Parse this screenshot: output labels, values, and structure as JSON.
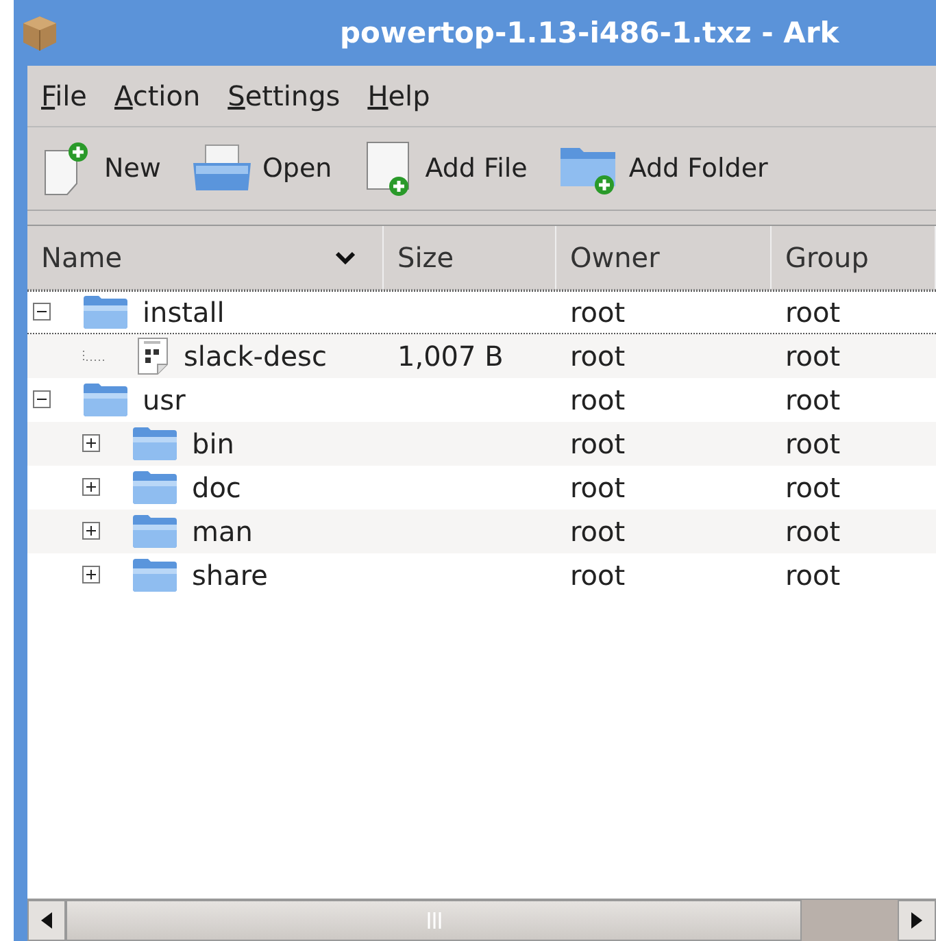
{
  "window": {
    "title": "powertop-1.13-i486-1.txz - Ark"
  },
  "menu": [
    "File",
    "Action",
    "Settings",
    "Help"
  ],
  "toolbar": [
    {
      "kind": "new",
      "label": "New"
    },
    {
      "kind": "open",
      "label": "Open"
    },
    {
      "kind": "add-file",
      "label": "Add File"
    },
    {
      "kind": "add-folder",
      "label": "Add Folder"
    }
  ],
  "table": {
    "columns": [
      {
        "label": "Name",
        "sorted": true
      },
      {
        "label": "Size",
        "sorted": false
      },
      {
        "label": "Owner",
        "sorted": false
      },
      {
        "label": "Group",
        "sorted": false
      }
    ],
    "rows": [
      {
        "kind": "folder",
        "name": "install",
        "owner": "root",
        "group": "root",
        "expanded": true,
        "focused": true,
        "children": [
          {
            "kind": "file",
            "name": "slack-desc",
            "size": "1,007 B",
            "owner": "root",
            "group": "root",
            "focused": false
          }
        ]
      },
      {
        "kind": "folder",
        "name": "usr",
        "owner": "root",
        "group": "root",
        "expanded": true,
        "focused": false,
        "children": [
          {
            "kind": "folder",
            "name": "bin",
            "owner": "root",
            "group": "root",
            "expanded": false,
            "focused": false
          },
          {
            "kind": "folder",
            "name": "doc",
            "owner": "root",
            "group": "root",
            "expanded": false,
            "focused": false
          },
          {
            "kind": "folder",
            "name": "man",
            "owner": "root",
            "group": "root",
            "expanded": false,
            "focused": false
          },
          {
            "kind": "folder",
            "name": "share",
            "owner": "root",
            "group": "root",
            "expanded": false,
            "focused": false
          }
        ]
      }
    ]
  }
}
